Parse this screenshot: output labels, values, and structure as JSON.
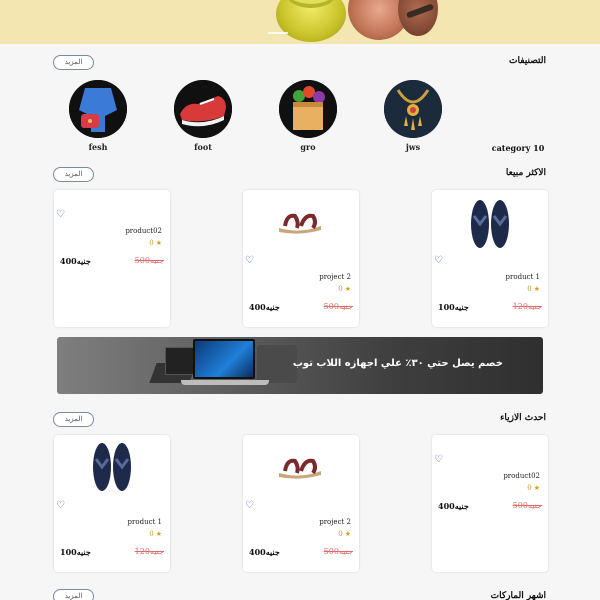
{
  "sections": {
    "categories": {
      "title": "التصنيفات",
      "more": "المزيد"
    },
    "best_selling": {
      "title": "الاكثر مبيعا",
      "more": "المزيد"
    },
    "latest_fashion": {
      "title": "احدث الازياء",
      "more": "المزيد"
    },
    "top_brands": {
      "title": "اشهر الماركات",
      "more": "المزيد"
    }
  },
  "categories": [
    {
      "label": "category 10",
      "icon": "empty"
    },
    {
      "label": "jws",
      "icon": "necklace-icon"
    },
    {
      "label": "gro",
      "icon": "grocery-bag-icon"
    },
    {
      "label": "foot",
      "icon": "sneaker-icon"
    },
    {
      "label": "fesh",
      "icon": "fashion-icon"
    }
  ],
  "best_selling_products": [
    {
      "name": "product 1",
      "rating_count": "0",
      "old_price": "120جنيه",
      "new_price": "100جنيه",
      "image": "sandal-blue-icon"
    },
    {
      "name": "project 2",
      "rating_count": "0",
      "old_price": "500جنيه",
      "new_price": "400جنيه",
      "image": "sandal-brown-icon"
    },
    {
      "name": "product02",
      "rating_count": "0",
      "old_price": "500جنيه",
      "new_price": "400جنيه",
      "image": "none"
    }
  ],
  "banner": {
    "text": "خصم يصل حتي ٣٠٪ علي اجهازه اللاب توب"
  },
  "latest_products": [
    {
      "name": "product02",
      "rating_count": "0",
      "old_price": "500جنيه",
      "new_price": "400جنيه",
      "image": "none"
    },
    {
      "name": "project 2",
      "rating_count": "0",
      "old_price": "500جنيه",
      "new_price": "400جنيه",
      "image": "sandal-brown-icon"
    },
    {
      "name": "product 1",
      "rating_count": "0",
      "old_price": "120جنيه",
      "new_price": "100جنيه",
      "image": "sandal-blue-icon"
    }
  ],
  "colors": {
    "hero_bg": "#f3e6b0",
    "heart": "#3b5f9a",
    "old_price": "#e26a6a",
    "star": "#f0b400"
  }
}
